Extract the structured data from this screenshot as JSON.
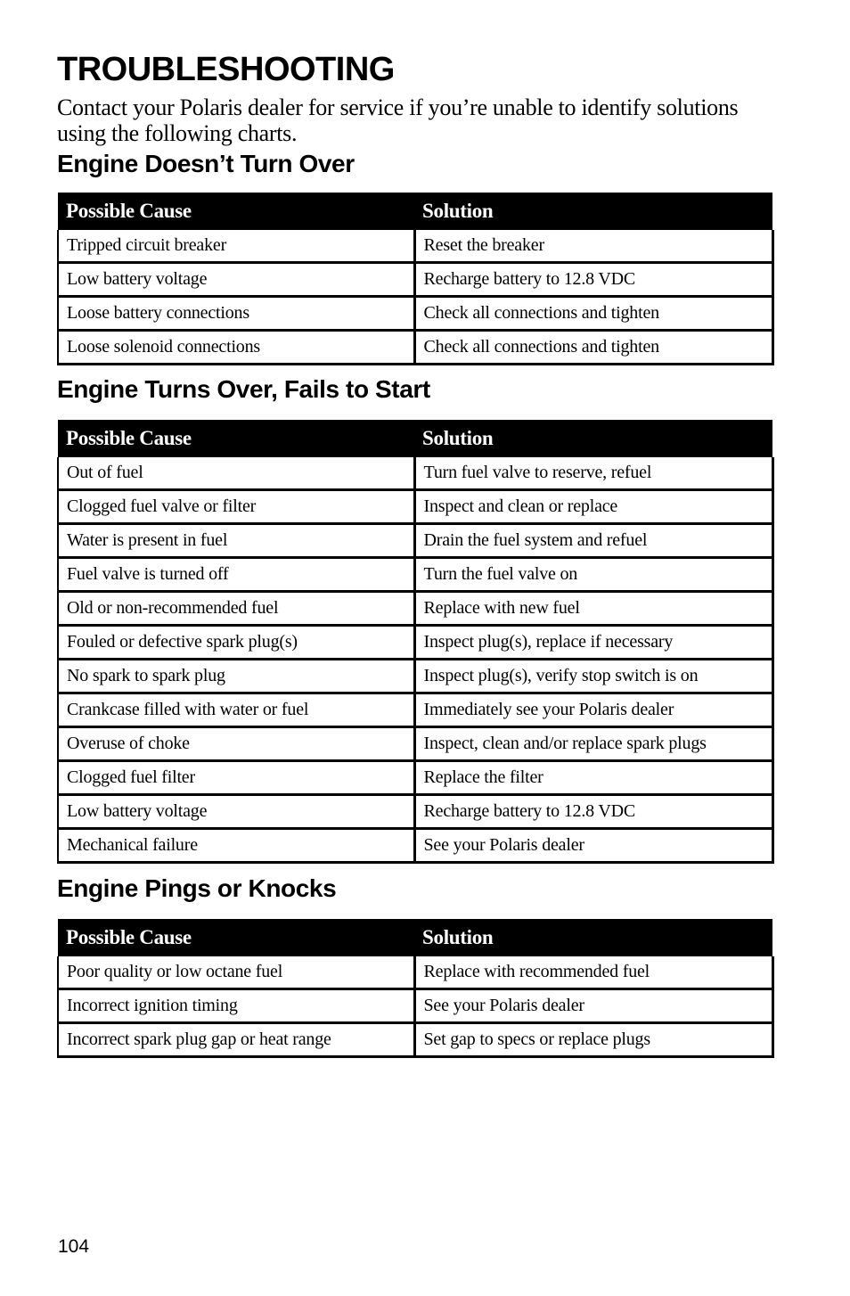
{
  "page": {
    "title": "TROUBLESHOOTING",
    "intro": "Contact your Polaris dealer for service if you’re unable to identify solutions using the following charts.",
    "page_number": "104"
  },
  "sections": [
    {
      "heading": "Engine Doesn’t Turn Over",
      "columns": [
        "Possible Cause",
        "Solution"
      ],
      "rows": [
        {
          "cause": "Tripped circuit breaker",
          "solution": "Reset the breaker"
        },
        {
          "cause": "Low battery voltage",
          "solution": "Recharge battery to 12.8 VDC"
        },
        {
          "cause": "Loose battery connections",
          "solution": "Check all connections and tighten"
        },
        {
          "cause": "Loose solenoid connections",
          "solution": "Check all connections and tighten"
        }
      ]
    },
    {
      "heading": "Engine Turns Over, Fails to Start",
      "columns": [
        "Possible Cause",
        "Solution"
      ],
      "rows": [
        {
          "cause": "Out of fuel",
          "solution": "Turn fuel valve to reserve, refuel"
        },
        {
          "cause": "Clogged fuel valve or filter",
          "solution": "Inspect and clean or replace"
        },
        {
          "cause": "Water is present in fuel",
          "solution": "Drain the fuel system and refuel"
        },
        {
          "cause": "Fuel valve is turned off",
          "solution": "Turn the fuel valve on"
        },
        {
          "cause": "Old or non-recommended fuel",
          "solution": "Replace with new fuel"
        },
        {
          "cause": "Fouled or defective spark plug(s)",
          "solution": "Inspect plug(s), replace if necessary"
        },
        {
          "cause": "No spark to spark plug",
          "solution": "Inspect plug(s), verify stop switch is on"
        },
        {
          "cause": "Crankcase filled with water or fuel",
          "solution": "Immediately see your Polaris dealer"
        },
        {
          "cause": "Overuse of choke",
          "solution": "Inspect, clean and/or replace spark plugs"
        },
        {
          "cause": "Clogged fuel filter",
          "solution": "Replace the filter"
        },
        {
          "cause": "Low battery voltage",
          "solution": "Recharge battery to 12.8 VDC"
        },
        {
          "cause": "Mechanical failure",
          "solution": "See your Polaris dealer"
        }
      ]
    },
    {
      "heading": "Engine Pings or Knocks",
      "columns": [
        "Possible Cause",
        "Solution"
      ],
      "rows": [
        {
          "cause": "Poor quality or low octane fuel",
          "solution": "Replace with recommended fuel"
        },
        {
          "cause": "Incorrect ignition timing",
          "solution": "See your Polaris dealer"
        },
        {
          "cause": "Incorrect spark plug gap or heat range",
          "solution": "Set gap to specs or replace plugs"
        }
      ]
    }
  ]
}
